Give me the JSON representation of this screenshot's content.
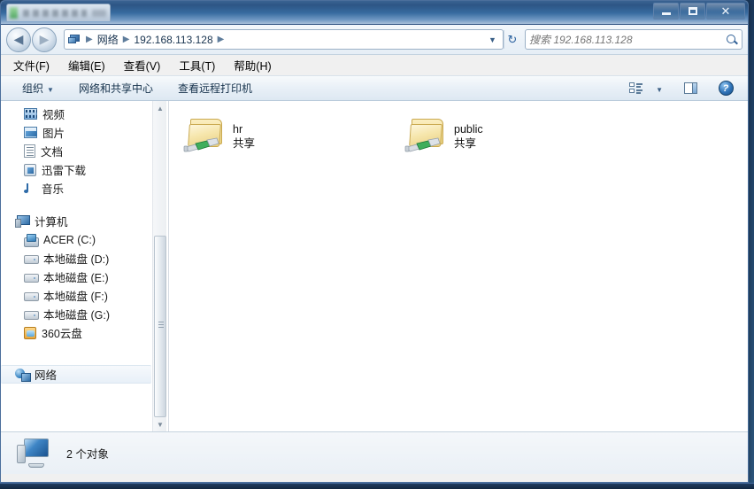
{
  "window": {
    "title_tab_blurred": "",
    "controls": {
      "minimize": "minimize-button",
      "maximize": "maximize-button",
      "close": "✕"
    }
  },
  "navigation": {
    "back_glyph": "◀",
    "forward_glyph": "▶",
    "dropdown_glyph": "▼",
    "refresh_glyph": "↻"
  },
  "address": {
    "icon": "network-computer-icon",
    "crumbs": [
      {
        "label": "网络"
      },
      {
        "label": "192.168.113.128"
      }
    ],
    "separator": "▶"
  },
  "search": {
    "placeholder": "搜索 192.168.113.128",
    "value": "",
    "icon": "search-icon"
  },
  "menubar": {
    "items": [
      {
        "label": "文件(F)"
      },
      {
        "label": "编辑(E)"
      },
      {
        "label": "查看(V)"
      },
      {
        "label": "工具(T)"
      },
      {
        "label": "帮助(H)"
      }
    ]
  },
  "commandbar": {
    "organize": "组织",
    "organize_caret": "▼",
    "network_sharing_center": "网络和共享中心",
    "view_remote_printers": "查看远程打印机",
    "view_options_icon": "view-options-icon",
    "view_options_caret": "▼",
    "preview_pane_icon": "preview-pane-icon",
    "help_icon": "?"
  },
  "sidebar": {
    "library_items": [
      {
        "label": "视频",
        "icon": "video-icon"
      },
      {
        "label": "图片",
        "icon": "picture-icon"
      },
      {
        "label": "文档",
        "icon": "document-icon"
      },
      {
        "label": "迅雷下载",
        "icon": "download-icon"
      },
      {
        "label": "音乐",
        "icon": "music-icon"
      }
    ],
    "computer_header": {
      "label": "计算机",
      "icon": "computer-icon"
    },
    "drives": [
      {
        "label": "ACER (C:)",
        "icon": "system-drive-icon"
      },
      {
        "label": "本地磁盘 (D:)",
        "icon": "drive-icon"
      },
      {
        "label": "本地磁盘 (E:)",
        "icon": "drive-icon"
      },
      {
        "label": "本地磁盘 (F:)",
        "icon": "drive-icon"
      },
      {
        "label": "本地磁盘 (G:)",
        "icon": "drive-icon"
      },
      {
        "label": "360云盘",
        "icon": "cloud-drive-icon"
      }
    ],
    "network_node": {
      "label": "网络",
      "icon": "network-icon",
      "selected": true
    },
    "scroll_up_glyph": "▲",
    "scroll_down_glyph": "▼"
  },
  "content": {
    "items": [
      {
        "name": "hr",
        "subtitle": "共享",
        "icon": "shared-folder-icon"
      },
      {
        "name": "public",
        "subtitle": "共享",
        "icon": "shared-folder-icon"
      }
    ]
  },
  "statusbar": {
    "icon": "computer-icon",
    "text": "2 个对象"
  },
  "colors": {
    "titlebar_blue": "#376b9f",
    "accent": "#2d6ba5",
    "folder_yellow": "#f6e6ac",
    "share_green": "#2f9e4f"
  }
}
